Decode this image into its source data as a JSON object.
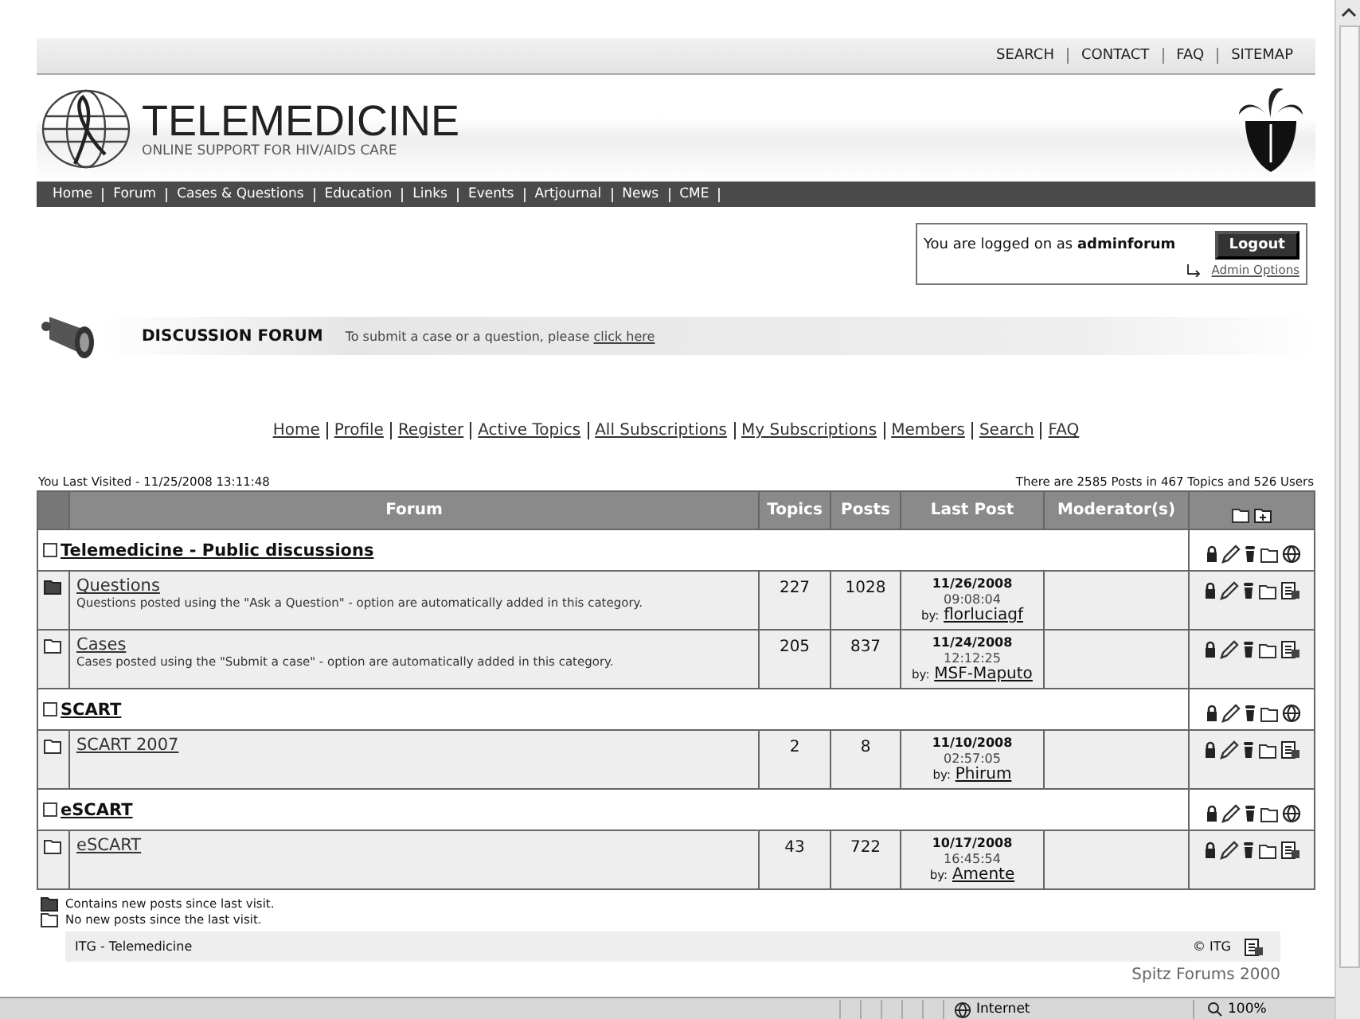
{
  "top_links": [
    "SEARCH",
    "CONTACT",
    "FAQ",
    "SITEMAP"
  ],
  "site": {
    "title": "TELEMEDICINE",
    "subtitle": "ONLINE SUPPORT FOR HIV/AIDS CARE"
  },
  "nav": [
    "Home",
    "Forum",
    "Cases & Questions",
    "Education",
    "Links",
    "Events",
    "Artjournal",
    "News",
    "CME"
  ],
  "login": {
    "text": "You are logged on as **adminforum**",
    "button": "Logout",
    "admin_link": "Admin Options"
  },
  "banner": {
    "title": "DISCUSSION FORUM",
    "text": "To submit a case or a question, please",
    "link": "click here"
  },
  "forum_links": [
    "Home",
    "Profile",
    "Register",
    "Active Topics",
    "All Subscriptions",
    "My Subscriptions",
    "Members",
    "Search",
    "FAQ"
  ],
  "last_visited": "You Last Visited - 11/25/2008 13:11:48",
  "stats": "There are 2585 Posts in 467 Topics and 526 Users",
  "table": {
    "columns": [
      "Forum",
      "Topics",
      "Posts",
      "Last Post",
      "Moderator(s)"
    ],
    "rows": [
      {
        "kind": "category",
        "title": "Telemedicine - Public discussions"
      },
      {
        "kind": "forum",
        "new_posts": true,
        "title": "Questions",
        "description": "Questions posted using the \"Ask a Question\" - option are automatically added in this category.",
        "topics": "227",
        "posts": "1028",
        "last_date": "11/26/2008",
        "last_time": "09:08:04",
        "by": "by:",
        "author": "florluciagf"
      },
      {
        "kind": "forum",
        "new_posts": false,
        "title": "Cases",
        "description": "Cases posted using the \"Submit a case\" - option are automatically added in this category.",
        "topics": "205",
        "posts": "837",
        "last_date": "11/24/2008",
        "last_time": "12:12:25",
        "by": "by:",
        "author": "MSF-Maputo"
      },
      {
        "kind": "category",
        "title": "SCART"
      },
      {
        "kind": "forum",
        "new_posts": false,
        "title": "SCART 2007",
        "topics": "2",
        "posts": "8",
        "last_date": "11/10/2008",
        "last_time": "02:57:05",
        "by": "by:",
        "author": "Phirum"
      },
      {
        "kind": "category",
        "title": "eSCART"
      },
      {
        "kind": "forum",
        "new_posts": false,
        "title": "eSCART",
        "topics": "43",
        "posts": "722",
        "last_date": "10/17/2008",
        "last_time": "16:45:54",
        "by": "by:",
        "author": "Amente"
      }
    ]
  },
  "legend": [
    {
      "new_posts": true,
      "text": "Contains new posts since last visit."
    },
    {
      "new_posts": false,
      "text": "No new posts since the last visit."
    }
  ],
  "footer": {
    "left": "ITG - Telemedicine",
    "right": "© ITG",
    "credit": "Spitz Forums 2000"
  },
  "status_bar": {
    "zone": "Internet",
    "zoom": "100%"
  }
}
